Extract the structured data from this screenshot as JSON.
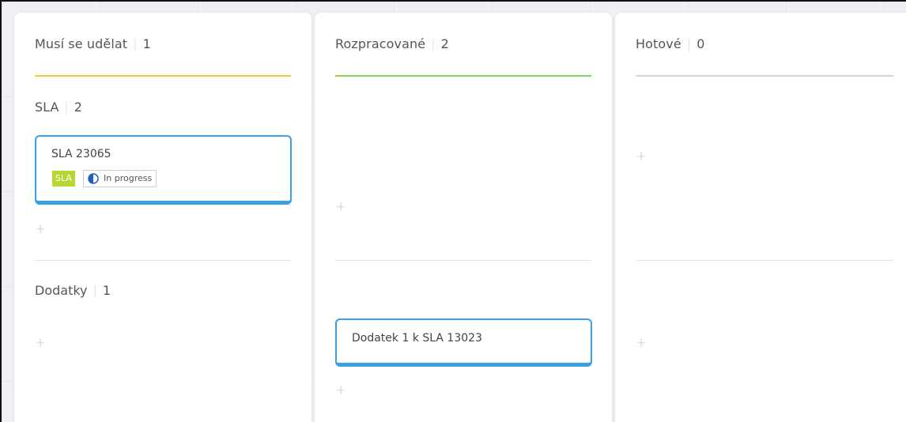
{
  "colors": {
    "todo_accent": "#f2cd2e",
    "in_progress_accent": "#8ad15a",
    "done_accent": "#d6d6d6",
    "card_border": "#3aa0e6",
    "sla_tag": "#b7d832"
  },
  "columns": [
    {
      "title": "Musí se udělat",
      "count": "1"
    },
    {
      "title": "Rozpracované",
      "count": "2"
    },
    {
      "title": "Hotové",
      "count": "0"
    }
  ],
  "swimlanes": [
    {
      "title": "SLA",
      "count": "2"
    },
    {
      "title": "Dodatky",
      "count": "1"
    }
  ],
  "cards": [
    {
      "title": "SLA 23065",
      "tag": "SLA",
      "status": {
        "label": "In progress",
        "icon": "half-circle-progress-icon"
      }
    },
    {
      "title": "Dodatek 1 k SLA 13023"
    }
  ],
  "add_label": "+"
}
